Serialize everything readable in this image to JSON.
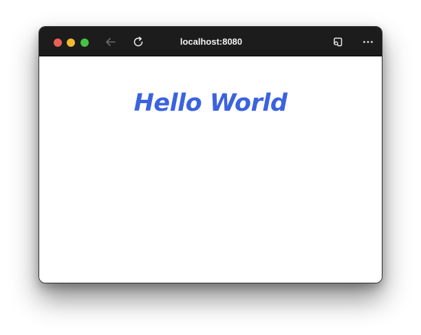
{
  "browser": {
    "url": "localhost:8080",
    "icons": {
      "back": "back-arrow-icon",
      "reload": "reload-icon",
      "cast": "cast-icon",
      "more": "more-options-icon"
    },
    "colors": {
      "titlebar": "#1c1c1c",
      "close": "#ee5f56",
      "minimize": "#f2bb2e",
      "maximize": "#45c43f"
    }
  },
  "page": {
    "heading": "Hello World",
    "heading_color": "#3b63de"
  }
}
